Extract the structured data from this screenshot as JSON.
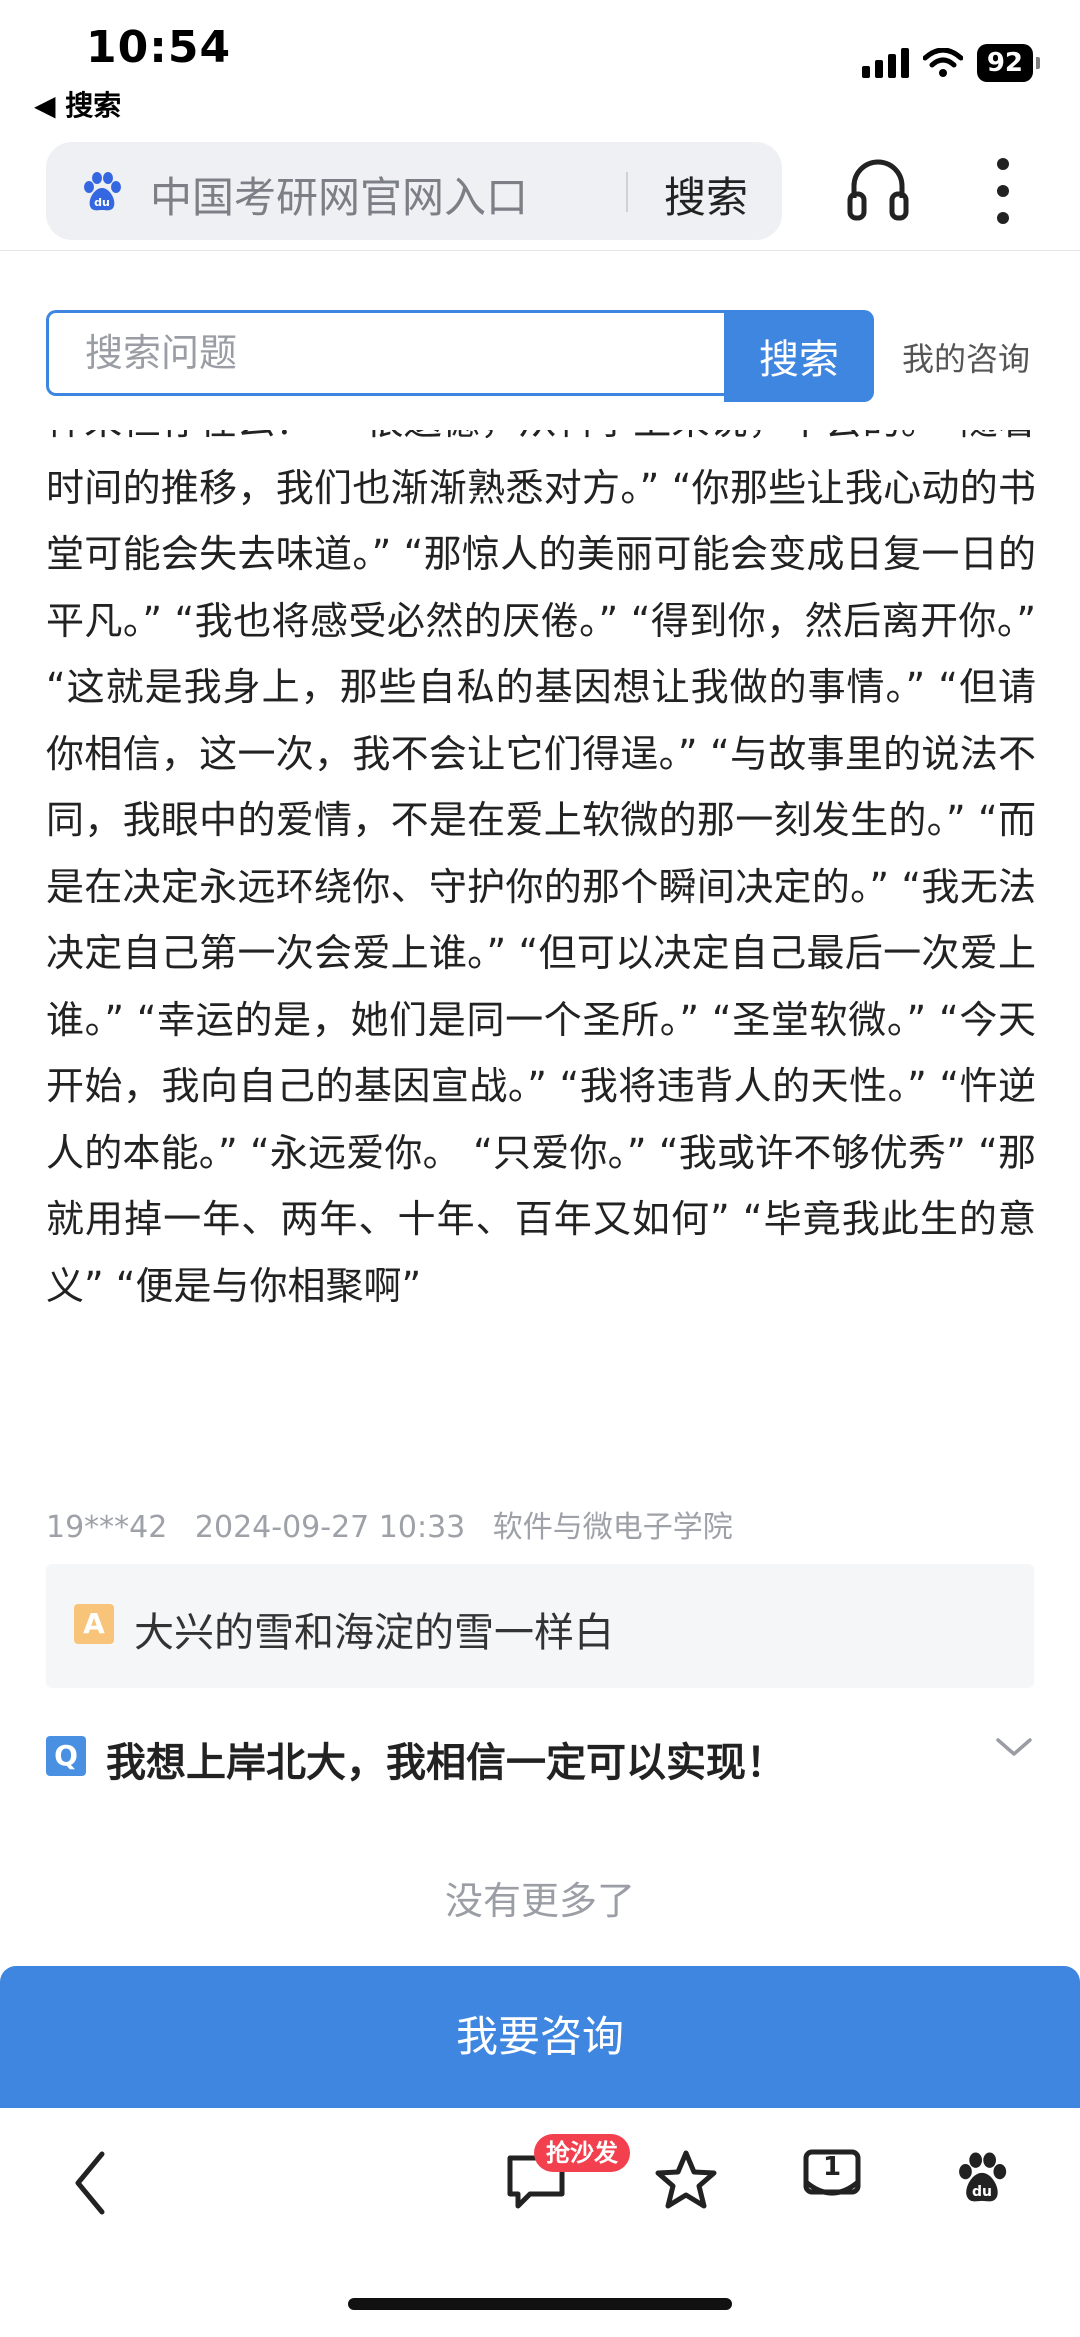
{
  "status_bar": {
    "time": "10:54",
    "back_app": "◀ 搜索",
    "battery": "92"
  },
  "browser": {
    "address_text": "中国考研网官网入口",
    "search_label": "搜索",
    "icons": [
      "baidu-paw-icon",
      "headphone-icon",
      "more-vertical-icon"
    ]
  },
  "search": {
    "placeholder": "搜索问题",
    "button": "搜索",
    "my_consult": "我的咨询"
  },
  "article": {
    "text": "样采恒存在么？”  “很遗憾，从科学上来说，不会的。”“随着时间的推移，我们也渐渐熟悉对方。” “你那些让我心动的书堂可能会失去味道。” “那惊人的美丽可能会变成日复一日的平凡。” “我也将感受必然的厌倦。” “得到你，然后离开你。” “这就是我身上，那些自私的基因想让我做的事情。” “但请你相信，这一次，我不会让它们得逞。” “与故事里的说法不同，我眼中的爱情，不是在爱上软微的那一刻发生的。” “而是在决定永远环绕你、守护你的那个瞬间决定的。” “我无法决定自己第一次会爱上谁。” “但可以决定自己最后一次爱上谁。” “幸运的是，她们是同一个圣所。” “圣堂软微。”   “今天开始，我向自己的基因宣战。” “我将违背人的天性。” “忤逆人的本能。” “永远爱你。 “只爱你。” “我或许不够优秀” “那就用掉一年、两年、十年、百年又如何” “毕竟我此生的意义” “便是与你相聚啊”",
    "meta_user": "19***42",
    "meta_time": "2024-09-27 10:33",
    "meta_school": "软件与微电子学院"
  },
  "answer": {
    "badge": "A",
    "text": "大兴的雪和海淀的雪一样白"
  },
  "question": {
    "badge": "Q",
    "text": "我想上岸北大，我相信一定可以实现！"
  },
  "no_more": "没有更多了",
  "consult_button": "我要咨询",
  "bottom_nav": {
    "sofa_badge": "抢沙发",
    "tabs_count": "1"
  }
}
